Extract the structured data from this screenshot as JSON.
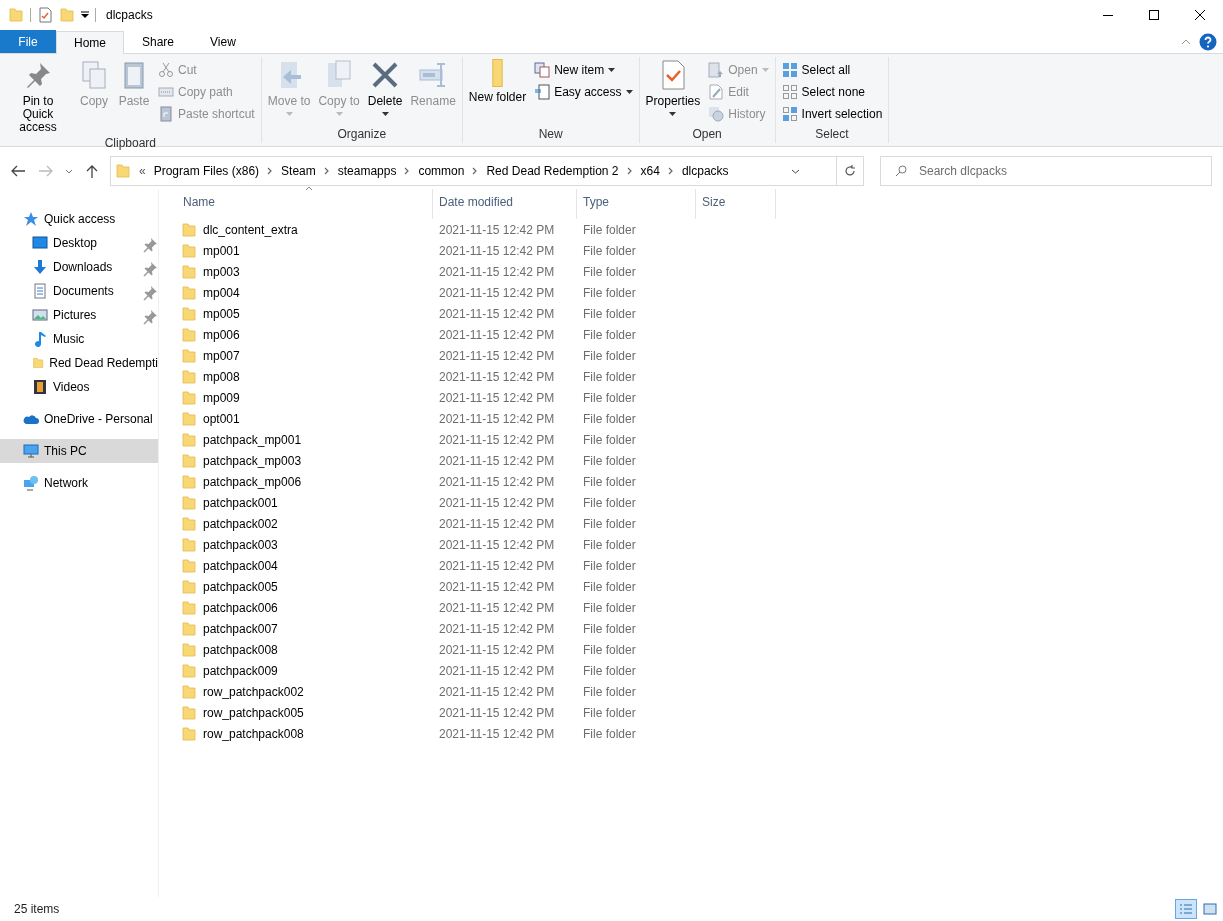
{
  "window": {
    "title": "dlcpacks"
  },
  "tabs": [
    {
      "label": "File",
      "kind": "file",
      "selected": false
    },
    {
      "label": "Home",
      "kind": "tab",
      "selected": true
    },
    {
      "label": "Share",
      "kind": "tab",
      "selected": false
    },
    {
      "label": "View",
      "kind": "tab",
      "selected": false
    }
  ],
  "ribbon": [
    {
      "label": "Clipboard",
      "items": [
        {
          "label": "Pin to Quick access",
          "kind": "large",
          "disabled": false,
          "dropdown": false
        },
        {
          "label": "Copy",
          "kind": "large",
          "disabled": true,
          "dropdown": false
        },
        {
          "label": "Paste",
          "kind": "large",
          "disabled": true,
          "dropdown": false
        },
        {
          "label": "Cut",
          "kind": "small",
          "disabled": true,
          "dropdown": false
        },
        {
          "label": "Copy path",
          "kind": "small",
          "disabled": true,
          "dropdown": false
        },
        {
          "label": "Paste shortcut",
          "kind": "small",
          "disabled": true,
          "dropdown": false
        }
      ]
    },
    {
      "label": "Organize",
      "items": [
        {
          "label": "Move to",
          "kind": "large",
          "disabled": true,
          "dropdown": true
        },
        {
          "label": "Copy to",
          "kind": "large",
          "disabled": true,
          "dropdown": true
        },
        {
          "label": "Delete",
          "kind": "large",
          "disabled": false,
          "dropdown": true
        },
        {
          "label": "Rename",
          "kind": "large",
          "disabled": true,
          "dropdown": false
        }
      ]
    },
    {
      "label": "New",
      "items": [
        {
          "label": "New folder",
          "kind": "large",
          "disabled": false,
          "dropdown": false
        },
        {
          "label": "New item",
          "kind": "small",
          "disabled": false,
          "dropdown": true
        },
        {
          "label": "Easy access",
          "kind": "small",
          "disabled": false,
          "dropdown": true
        }
      ]
    },
    {
      "label": "Open",
      "items": [
        {
          "label": "Properties",
          "kind": "large",
          "disabled": false,
          "dropdown": true
        },
        {
          "label": "Open",
          "kind": "small",
          "disabled": true,
          "dropdown": true
        },
        {
          "label": "Edit",
          "kind": "small",
          "disabled": true,
          "dropdown": false
        },
        {
          "label": "History",
          "kind": "small",
          "disabled": true,
          "dropdown": false
        }
      ]
    },
    {
      "label": "Select",
      "items": [
        {
          "label": "Select all",
          "kind": "small",
          "disabled": false,
          "dropdown": false
        },
        {
          "label": "Select none",
          "kind": "small",
          "disabled": false,
          "dropdown": false
        },
        {
          "label": "Invert selection",
          "kind": "small",
          "disabled": false,
          "dropdown": false
        }
      ]
    }
  ],
  "address": {
    "overflow": "«",
    "crumbs": [
      "Program Files (x86)",
      "Steam",
      "steamapps",
      "common",
      "Red Dead Redemption 2",
      "x64",
      "dlcpacks"
    ]
  },
  "search": {
    "placeholder": "Search dlcpacks"
  },
  "sidebar": {
    "items": [
      {
        "label": "Quick access",
        "selected": false,
        "children": [
          {
            "label": "Desktop",
            "pinned": true,
            "selected": false
          },
          {
            "label": "Downloads",
            "pinned": true,
            "selected": false
          },
          {
            "label": "Documents",
            "pinned": true,
            "selected": false
          },
          {
            "label": "Pictures",
            "pinned": true,
            "selected": false
          },
          {
            "label": "Music",
            "pinned": false,
            "selected": false
          },
          {
            "label": "Red Dead Redempti",
            "pinned": false,
            "selected": false
          },
          {
            "label": "Videos",
            "pinned": false,
            "selected": false
          }
        ]
      },
      {
        "label": "OneDrive - Personal",
        "selected": false
      },
      {
        "label": "This PC",
        "selected": true
      },
      {
        "label": "Network",
        "selected": false
      }
    ]
  },
  "table": {
    "columns": [
      {
        "label": "Name",
        "sorted": true
      },
      {
        "label": "Date modified",
        "sorted": false
      },
      {
        "label": "Type",
        "sorted": false
      },
      {
        "label": "Size",
        "sorted": false
      }
    ],
    "rows": [
      [
        "dlc_content_extra",
        "2021-11-15 12:42 PM",
        "File folder"
      ],
      [
        "mp001",
        "2021-11-15 12:42 PM",
        "File folder"
      ],
      [
        "mp003",
        "2021-11-15 12:42 PM",
        "File folder"
      ],
      [
        "mp004",
        "2021-11-15 12:42 PM",
        "File folder"
      ],
      [
        "mp005",
        "2021-11-15 12:42 PM",
        "File folder"
      ],
      [
        "mp006",
        "2021-11-15 12:42 PM",
        "File folder"
      ],
      [
        "mp007",
        "2021-11-15 12:42 PM",
        "File folder"
      ],
      [
        "mp008",
        "2021-11-15 12:42 PM",
        "File folder"
      ],
      [
        "mp009",
        "2021-11-15 12:42 PM",
        "File folder"
      ],
      [
        "opt001",
        "2021-11-15 12:42 PM",
        "File folder"
      ],
      [
        "patchpack_mp001",
        "2021-11-15 12:42 PM",
        "File folder"
      ],
      [
        "patchpack_mp003",
        "2021-11-15 12:42 PM",
        "File folder"
      ],
      [
        "patchpack_mp006",
        "2021-11-15 12:42 PM",
        "File folder"
      ],
      [
        "patchpack001",
        "2021-11-15 12:42 PM",
        "File folder"
      ],
      [
        "patchpack002",
        "2021-11-15 12:42 PM",
        "File folder"
      ],
      [
        "patchpack003",
        "2021-11-15 12:42 PM",
        "File folder"
      ],
      [
        "patchpack004",
        "2021-11-15 12:42 PM",
        "File folder"
      ],
      [
        "patchpack005",
        "2021-11-15 12:42 PM",
        "File folder"
      ],
      [
        "patchpack006",
        "2021-11-15 12:42 PM",
        "File folder"
      ],
      [
        "patchpack007",
        "2021-11-15 12:42 PM",
        "File folder"
      ],
      [
        "patchpack008",
        "2021-11-15 12:42 PM",
        "File folder"
      ],
      [
        "patchpack009",
        "2021-11-15 12:42 PM",
        "File folder"
      ],
      [
        "row_patchpack002",
        "2021-11-15 12:42 PM",
        "File folder"
      ],
      [
        "row_patchpack005",
        "2021-11-15 12:42 PM",
        "File folder"
      ],
      [
        "row_patchpack008",
        "2021-11-15 12:42 PM",
        "File folder"
      ]
    ]
  },
  "status_bar": {
    "count": "25 items",
    "views": [
      {
        "kind": "details",
        "selected": true
      },
      {
        "kind": "large-icons",
        "selected": false
      }
    ]
  }
}
